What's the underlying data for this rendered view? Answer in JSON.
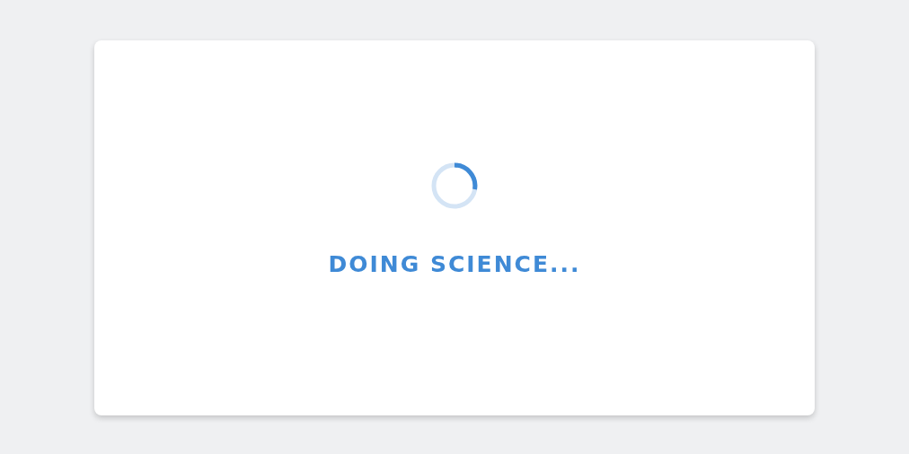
{
  "loading_card": {
    "message": "DOING SCIENCE..."
  }
}
